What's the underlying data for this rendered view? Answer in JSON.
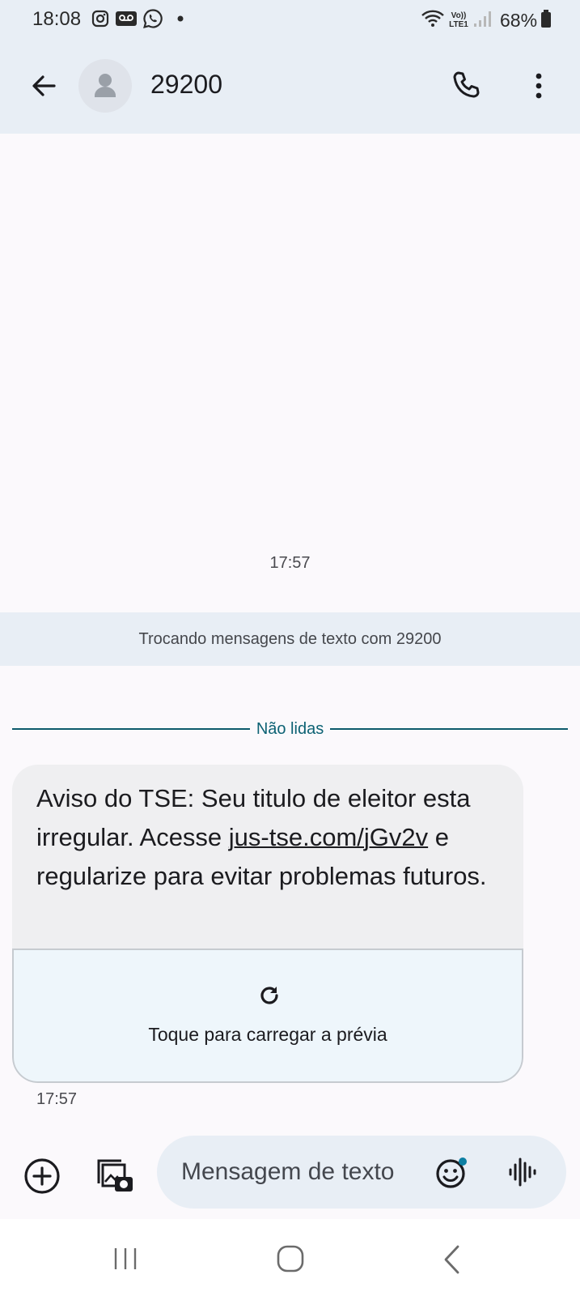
{
  "status_bar": {
    "time": "18:08",
    "left_icons": [
      "instagram-icon",
      "voicemail-icon",
      "whatsapp-icon",
      "notification-dot-icon"
    ],
    "right_icons": [
      "wifi-icon",
      "volte-lte-icon",
      "signal-icon"
    ],
    "volte_label": "Vo)) LTE1",
    "battery": "68%"
  },
  "header": {
    "contact_name": "29200",
    "icons": [
      "back-arrow-icon",
      "person-icon",
      "phone-icon",
      "more-vert-icon"
    ]
  },
  "conversation": {
    "first_timestamp": "17:57",
    "info_banner": "Trocando mensagens de texto com 29200",
    "unread_label": "Não lidas",
    "message": {
      "text_before_link": "Aviso do TSE: Seu titulo de eleitor esta irregular. Acesse ",
      "link": "jus-tse.com/jGv2v",
      "text_after_link": " e regularize para evitar problemas futuros.",
      "preview_label": "Toque para carregar a prévia",
      "timestamp": "17:57"
    }
  },
  "composer": {
    "placeholder": "Mensagem de texto",
    "icons": [
      "add-icon",
      "gallery-camera-icon",
      "emoji-icon",
      "voice-wave-icon"
    ]
  },
  "colors": {
    "header_bg": "#e8eef5",
    "page_bg": "#fbf9fc",
    "bubble_bg": "#efeff1",
    "preview_bg": "#eef6fb",
    "accent": "#0d6274"
  }
}
